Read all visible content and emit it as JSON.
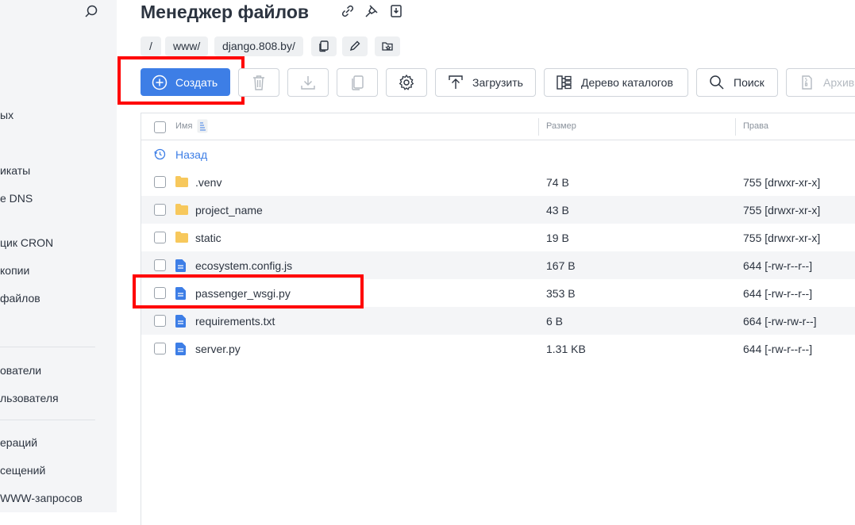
{
  "sidebar": {
    "items": [
      {
        "label": "ых"
      },
      {
        "label": "икаты"
      },
      {
        "label": "e DNS"
      },
      {
        "label": "цик CRON"
      },
      {
        "label": " копии"
      },
      {
        "label": " файлов"
      },
      {
        "label": "ователи"
      },
      {
        "label": "льзователя"
      },
      {
        "label": "ераций"
      },
      {
        "label": "сещений"
      },
      {
        "label": "WWW-запросов"
      }
    ]
  },
  "header": {
    "title": "Менеджер файлов"
  },
  "breadcrumb": {
    "root": "/",
    "items": [
      "www/",
      "django.808.by/"
    ]
  },
  "toolbar": {
    "create": "Создать",
    "upload": "Загрузить",
    "tree": "Дерево каталогов",
    "search": "Поиск",
    "archive": "Архив"
  },
  "table": {
    "headers": {
      "name": "Имя",
      "size": "Размер",
      "perms": "Права"
    },
    "back": "Назад",
    "rows": [
      {
        "name": ".venv",
        "type": "folder",
        "size": "74 B",
        "perms": "755 [drwxr-xr-x]"
      },
      {
        "name": "project_name",
        "type": "folder",
        "size": "43 B",
        "perms": "755 [drwxr-xr-x]"
      },
      {
        "name": "static",
        "type": "folder",
        "size": "19 B",
        "perms": "755 [drwxr-xr-x]"
      },
      {
        "name": "ecosystem.config.js",
        "type": "file",
        "size": "167 B",
        "perms": "644 [-rw-r--r--]"
      },
      {
        "name": "passenger_wsgi.py",
        "type": "file",
        "size": "353 B",
        "perms": "644 [-rw-r--r--]"
      },
      {
        "name": "requirements.txt",
        "type": "file",
        "size": "6 B",
        "perms": "664 [-rw-rw-r--]"
      },
      {
        "name": "server.py",
        "type": "file",
        "size": "1.31 KB",
        "perms": "644 [-rw-r--r--]"
      }
    ]
  },
  "colors": {
    "accent": "#3d7ee6",
    "folder": "#f7c85c",
    "file": "#3d7ee6",
    "highlight": "#ff0000"
  }
}
